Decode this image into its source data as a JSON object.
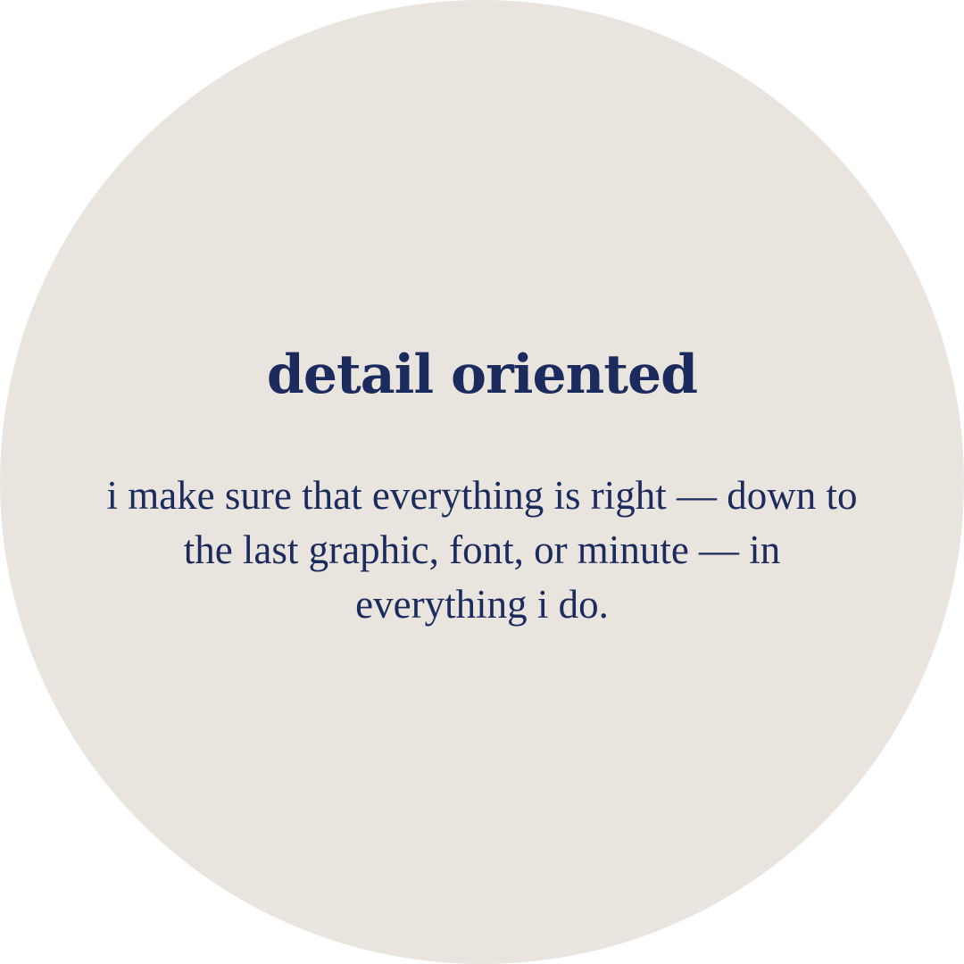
{
  "card": {
    "title": "detail oriented",
    "description": "i make sure that everything is right — down to the last graphic, font, or minute — in everything i do."
  },
  "colors": {
    "circle_background": "#E9E4DE",
    "text": "#1B2B5E",
    "page_background": "#FFFFFF"
  }
}
